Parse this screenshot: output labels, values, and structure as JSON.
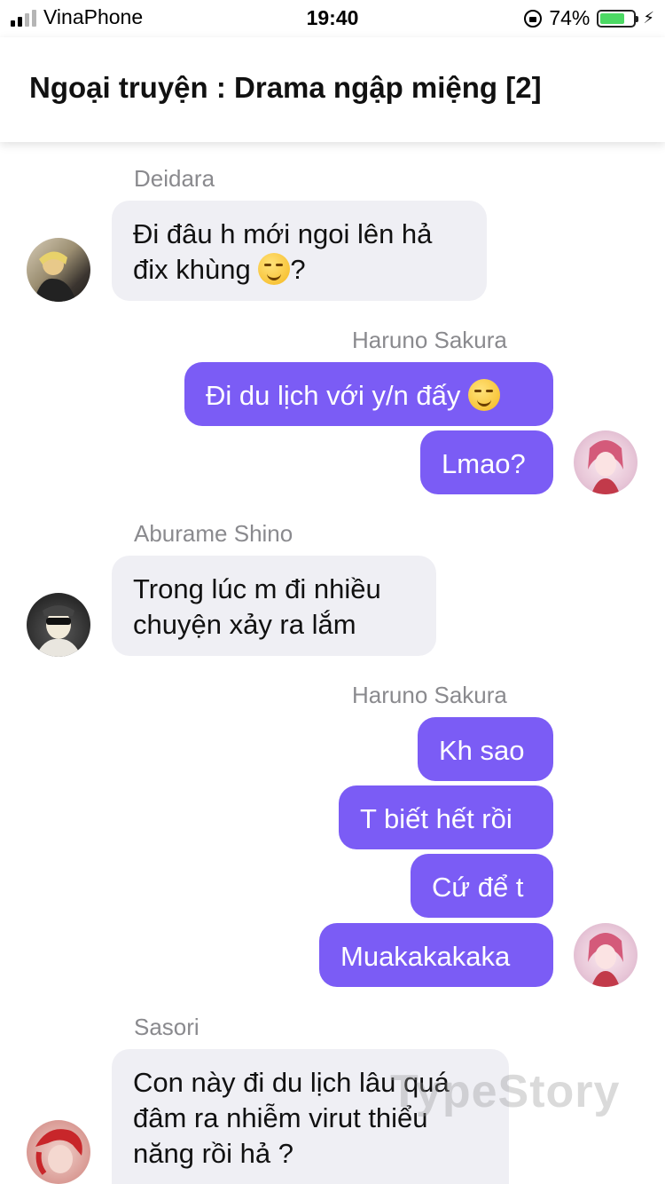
{
  "status": {
    "carrier": "VinaPhone",
    "time": "19:40",
    "battery": "74%",
    "battery_level": 0.74
  },
  "chat": {
    "title": "Ngoại truyện : Drama ngập miệng [2]"
  },
  "names": {
    "deidara": "Deidara",
    "sakura": "Haruno Sakura",
    "shino": "Aburame Shino",
    "sasori": "Sasori"
  },
  "messages": {
    "m1": "Đi đâu h mới ngoi lên hả",
    "m1b": "đix khùng",
    "m1c": "?",
    "m2": "Đi du lịch với y/n đấy",
    "m3": "Lmao?",
    "m4a": "Trong lúc m đi nhiều",
    "m4b": "chuyện xảy ra lắm",
    "m5": "Kh sao",
    "m6": "T biết hết rồi",
    "m7": "Cứ để t",
    "m8": "Muakakakaka",
    "m9a": "Con này đi du lịch lâu quá",
    "m9b": "đâm ra nhiễm virut thiểu",
    "m9c": "năng rồi hả ?"
  },
  "icons": {
    "smirk": "smirking-face-emoji",
    "lock": "rotation-lock-icon",
    "bolt": "charging-bolt-icon"
  },
  "watermark": "TypeStory",
  "colors": {
    "outgoing": "#7b5cf5",
    "incoming": "#efeff4",
    "battery": "#4cd964"
  }
}
